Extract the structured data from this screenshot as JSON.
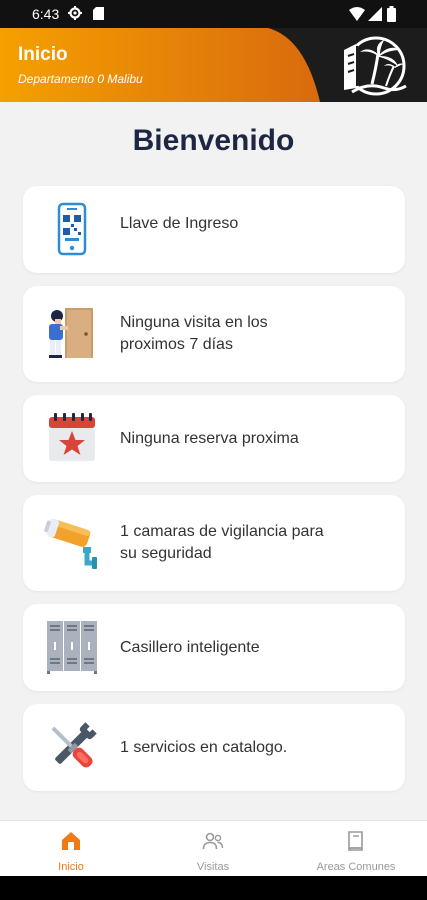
{
  "status_bar": {
    "time": "6:43"
  },
  "header": {
    "title": "Inicio",
    "subtitle": "Departamento 0 Malibu",
    "gradient_start": "#f5a000",
    "gradient_end": "#d96a0e"
  },
  "welcome": "Bienvenido",
  "cards": [
    {
      "label": "Llave de Ingreso",
      "icon": "qr-phone-icon"
    },
    {
      "label_line1": "Ninguna visita en los",
      "label_line2": "proximos 7 días",
      "icon": "visitor-door-icon"
    },
    {
      "label": "Ninguna reserva proxima",
      "icon": "calendar-star-icon"
    },
    {
      "label_line1": "1 camaras de vigilancia para",
      "label_line2": "su seguridad",
      "icon": "security-camera-icon"
    },
    {
      "label": "Casillero inteligente",
      "icon": "lockers-icon"
    },
    {
      "label": "1 servicios en catalogo.",
      "icon": "tools-icon"
    }
  ],
  "bottom_nav": [
    {
      "label": "Inicio",
      "icon": "home-icon",
      "active": true
    },
    {
      "label": "Visitas",
      "icon": "people-icon",
      "active": false
    },
    {
      "label": "Areas Comunes",
      "icon": "book-icon",
      "active": false
    }
  ],
  "colors": {
    "accent": "#f07a18",
    "title": "#1d2744",
    "background": "#f2f2f2"
  }
}
